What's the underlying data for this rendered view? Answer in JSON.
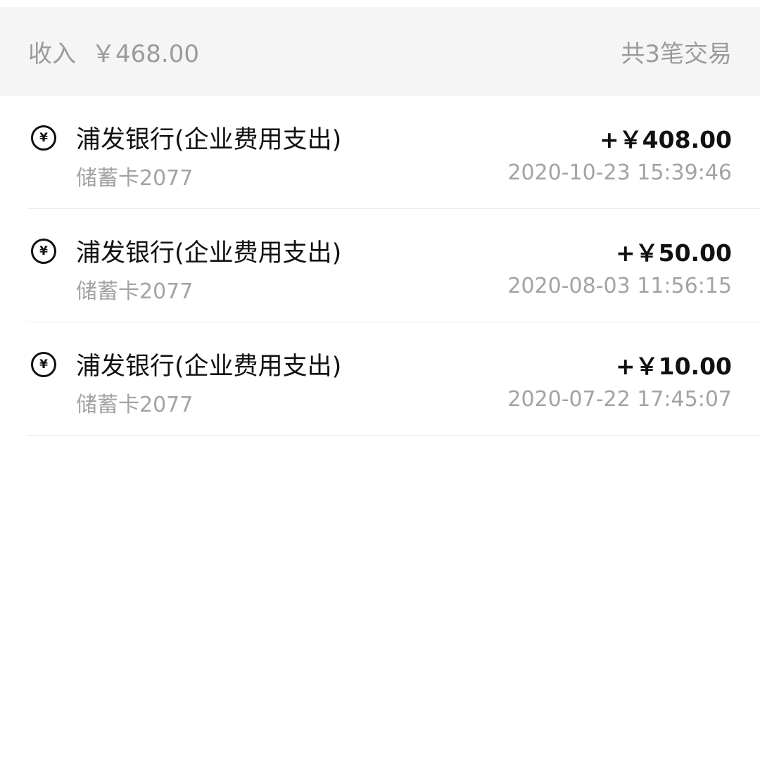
{
  "summary": {
    "income_label": "收入",
    "income_amount": "￥468.00",
    "count_text": "共3笔交易"
  },
  "transactions": [
    {
      "icon": "yuan-icon",
      "title": "浦发银行(企业费用支出)",
      "account": "储蓄卡2077",
      "amount": "+￥408.00",
      "time": "2020-10-23 15:39:46"
    },
    {
      "icon": "yuan-icon",
      "title": "浦发银行(企业费用支出)",
      "account": "储蓄卡2077",
      "amount": "+￥50.00",
      "time": "2020-08-03 11:56:15"
    },
    {
      "icon": "yuan-icon",
      "title": "浦发银行(企业费用支出)",
      "account": "储蓄卡2077",
      "amount": "+￥10.00",
      "time": "2020-07-22 17:45:07"
    }
  ],
  "icon_glyph": "¥",
  "colors": {
    "summary_bg": "#f5f5f5",
    "muted_text": "#9b9b9b",
    "primary_text": "#111111",
    "divider": "#ececec"
  }
}
